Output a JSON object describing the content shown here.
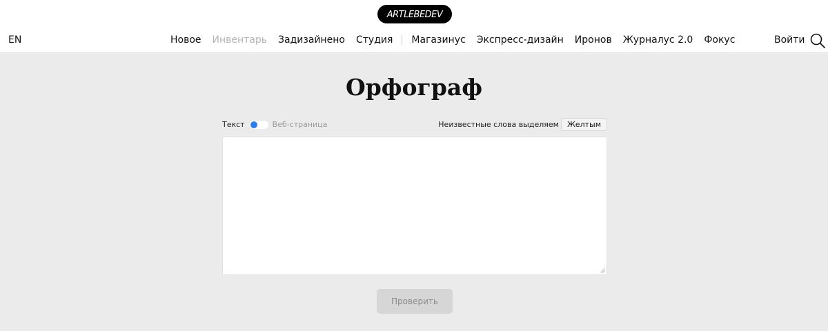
{
  "header": {
    "logo_text": "ARTLEBEDEV",
    "lang": "EN",
    "nav": [
      {
        "label": "Новое",
        "state": "normal"
      },
      {
        "label": "Инвентарь",
        "state": "dim"
      },
      {
        "label": "Задизайнено",
        "state": "normal"
      },
      {
        "label": "Студия",
        "state": "normal"
      },
      {
        "label": "Магазинус",
        "state": "normal"
      },
      {
        "label": "Экспресс-дизайн",
        "state": "normal"
      },
      {
        "label": "Иронов",
        "state": "normal"
      },
      {
        "label": "Журналус 2.0",
        "state": "normal"
      },
      {
        "label": "Фокус",
        "state": "normal"
      }
    ],
    "login": "Войти",
    "search_icon": "search-icon"
  },
  "main": {
    "title": "Орфограф",
    "mode": {
      "text_label": "Текст",
      "web_label": "Веб-страница",
      "selected": "Текст"
    },
    "highlight": {
      "label": "Неизвестные слова выделяем",
      "color_value": "Желтым"
    },
    "textarea_value": "",
    "check_button": "Проверить"
  },
  "colors": {
    "page_bg": "#ebebeb",
    "header_bg": "#ffffff",
    "accent": "#2e7de9",
    "button_bg": "#d6d6d6",
    "dim_text": "#b5b5b5"
  }
}
